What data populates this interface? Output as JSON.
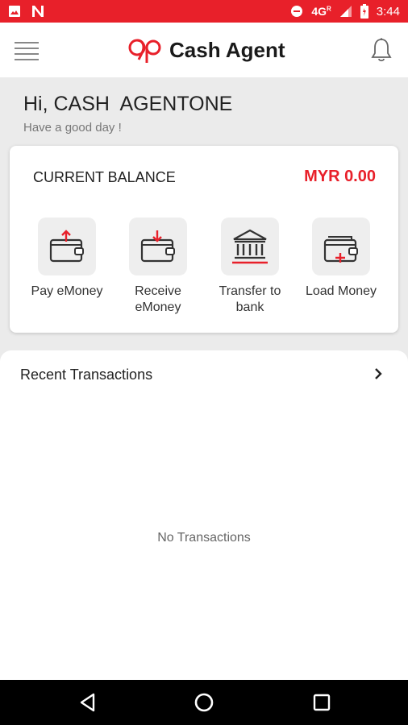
{
  "status_bar": {
    "network": "4G",
    "network_sup": "R",
    "time": "3:44"
  },
  "app_bar": {
    "title": "Cash Agent"
  },
  "greeting": {
    "name": "Hi, CASH  AGENTONE",
    "subtitle": "Have a good day !"
  },
  "balance": {
    "label": "CURRENT BALANCE",
    "value": "MYR 0.00"
  },
  "actions": [
    {
      "label": "Pay eMoney",
      "icon": "wallet-upload-icon"
    },
    {
      "label": "Receive eMoney",
      "icon": "wallet-download-icon"
    },
    {
      "label": "Transfer to bank",
      "icon": "bank-icon"
    },
    {
      "label": "Load Money",
      "icon": "wallet-add-icon"
    }
  ],
  "transactions": {
    "title": "Recent Transactions",
    "empty_text": "No Transactions"
  },
  "colors": {
    "accent": "#e8202a",
    "background": "#ebebeb",
    "tile": "#eeeeee"
  }
}
